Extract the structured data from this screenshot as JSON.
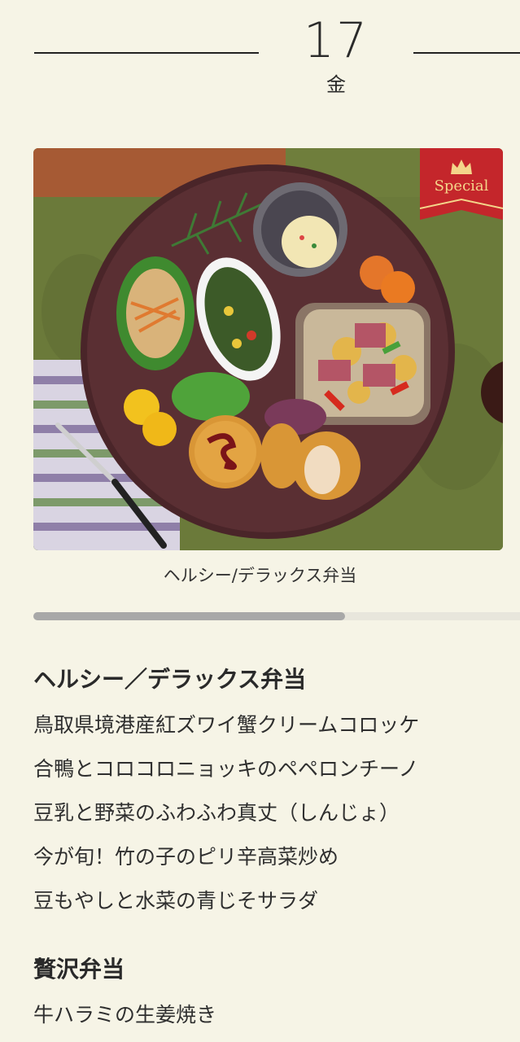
{
  "header": {
    "day": "17",
    "weekday": "金"
  },
  "photo": {
    "badge_label": "Special",
    "badge_icon": "crown-icon",
    "colors": {
      "badge_red": "#c4262b",
      "badge_gold": "#f4d58a",
      "placemat": "#6b7a3a",
      "plate": "#5a2f33"
    }
  },
  "caption": "ヘルシー/デラックス弁当",
  "carousel": {
    "progress_fraction": 0.64
  },
  "menu": {
    "groups": [
      {
        "title": "ヘルシー／デラックス弁当",
        "items": [
          "鳥取県境港産紅ズワイ蟹クリームコロッケ",
          "合鴨とコロコロニョッキのペペロンチーノ",
          "豆乳と野菜のふわふわ真丈（しんじょ）",
          "今が旬！竹の子のピリ辛高菜炒め",
          "豆もやしと水菜の青じそサラダ"
        ]
      },
      {
        "title": "贅沢弁当",
        "items": [
          "牛ハラミの生姜焼き"
        ]
      }
    ]
  }
}
